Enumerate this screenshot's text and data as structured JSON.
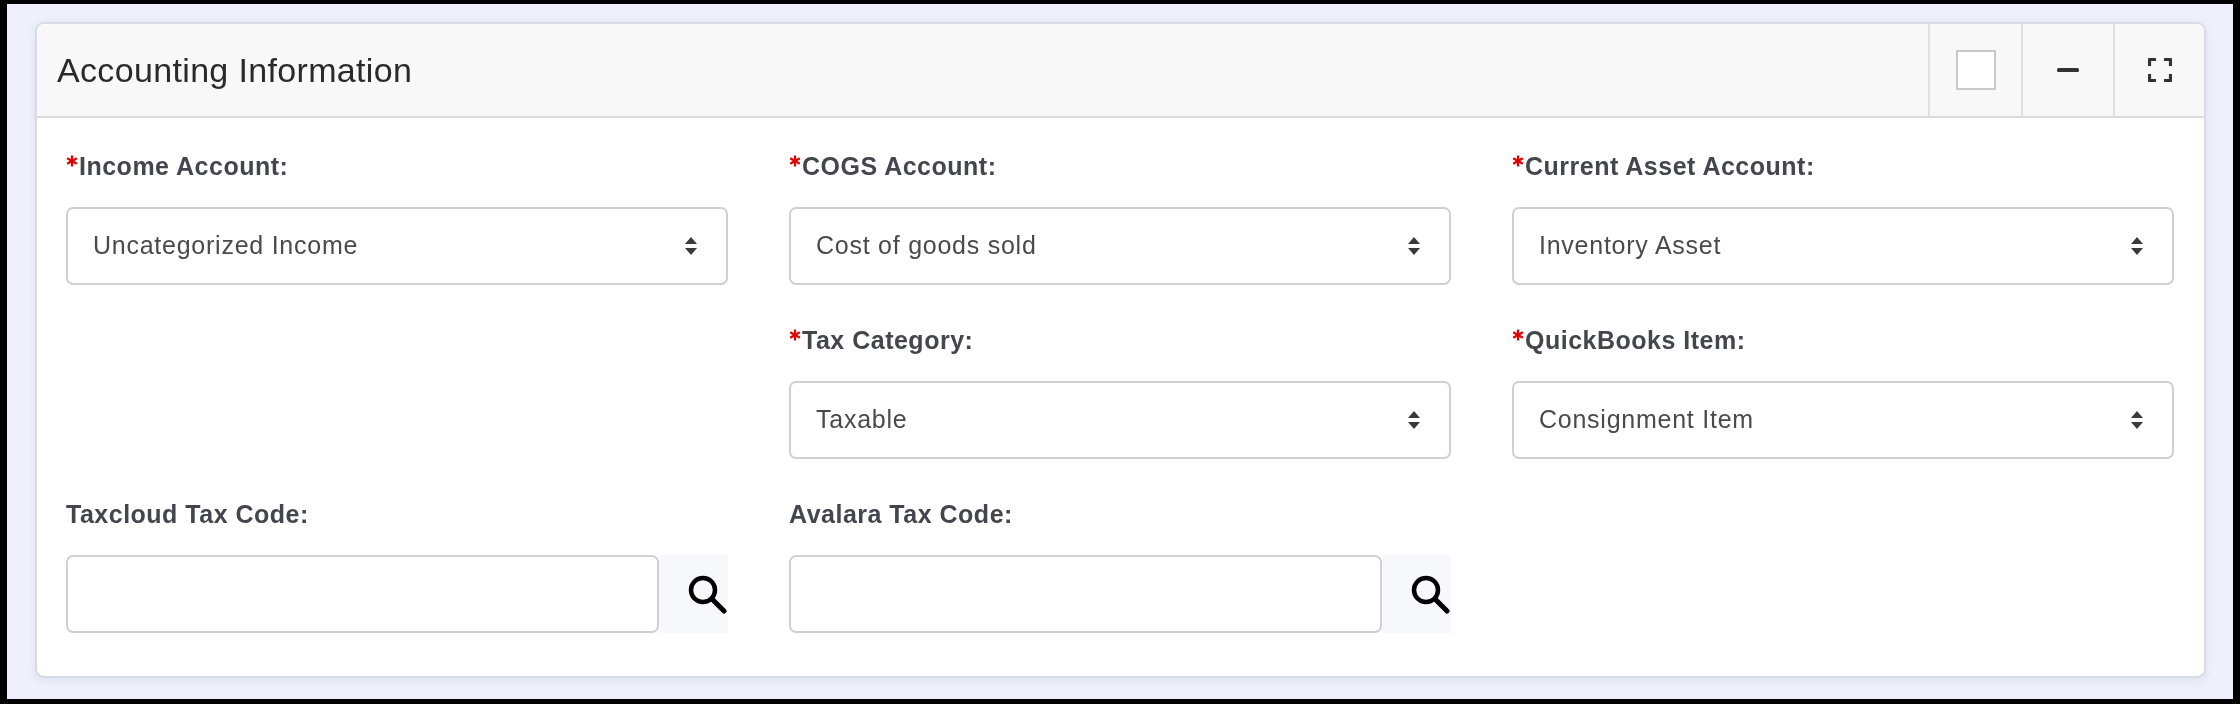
{
  "panel": {
    "title": "Accounting Information",
    "checkbox": {
      "checked": false
    }
  },
  "rows": [
    [
      {
        "kind": "select",
        "label": "Income Account:",
        "required": true,
        "value": "Uncategorized Income"
      },
      {
        "kind": "select",
        "label": "COGS Account:",
        "required": true,
        "value": "Cost of goods sold"
      },
      {
        "kind": "select",
        "label": "Current Asset Account:",
        "required": true,
        "value": "Inventory Asset"
      }
    ],
    [
      {
        "kind": "select",
        "label": "Tax Category:",
        "required": true,
        "value": "Taxable"
      },
      {
        "kind": "select",
        "label": "QuickBooks Item:",
        "required": true,
        "value": "Consignment Item"
      }
    ],
    [
      {
        "kind": "lookup",
        "label": "Taxcloud Tax Code:",
        "required": false
      },
      {
        "kind": "lookup",
        "label": "Avalara Tax Code:",
        "required": false
      }
    ]
  ]
}
